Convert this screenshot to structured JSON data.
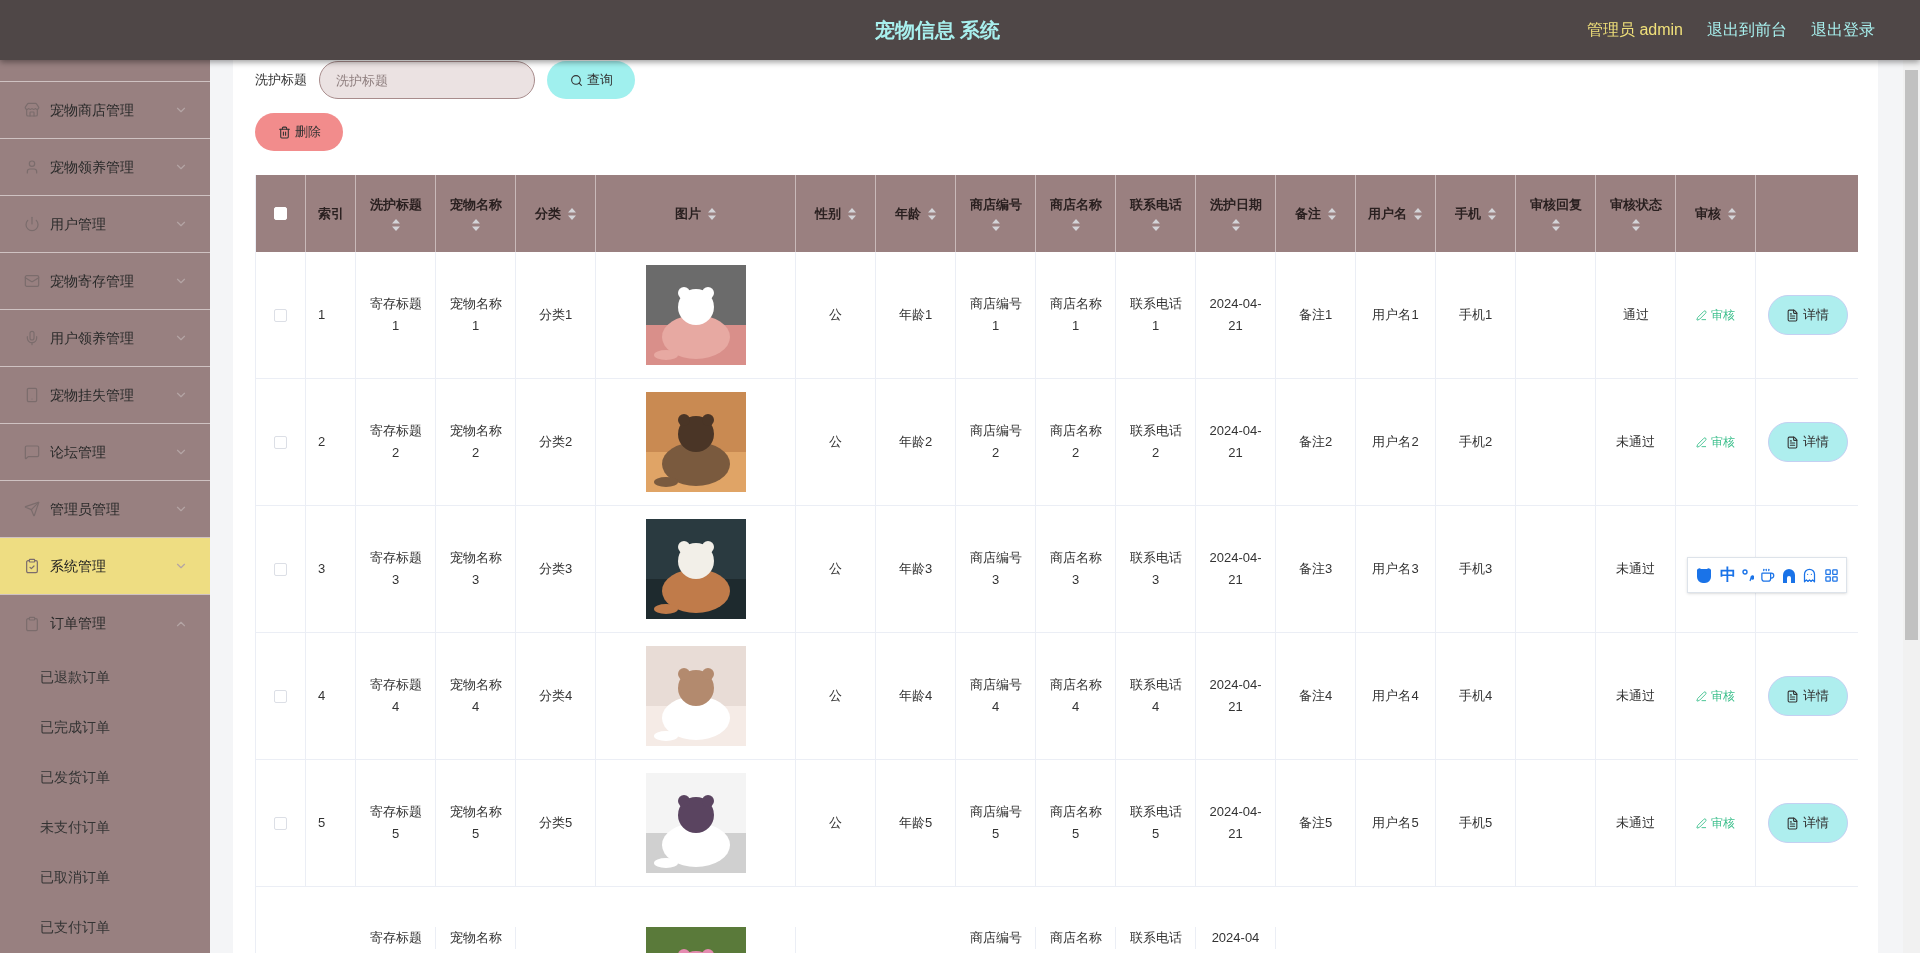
{
  "header": {
    "title": "宠物信息 系统",
    "user": "管理员 admin",
    "links": [
      "退出到前台",
      "退出登录"
    ]
  },
  "sidebar": {
    "items": [
      {
        "label": "宠物商店管理",
        "selected": false,
        "expanded": false
      },
      {
        "label": "宠物领养管理",
        "selected": false,
        "expanded": false
      },
      {
        "label": "用户管理",
        "selected": false,
        "expanded": false
      },
      {
        "label": "宠物寄存管理",
        "selected": false,
        "expanded": false
      },
      {
        "label": "用户领养管理",
        "selected": false,
        "expanded": false
      },
      {
        "label": "宠物挂失管理",
        "selected": false,
        "expanded": false
      },
      {
        "label": "论坛管理",
        "selected": false,
        "expanded": false
      },
      {
        "label": "管理员管理",
        "selected": false,
        "expanded": false
      },
      {
        "label": "系统管理",
        "selected": true,
        "expanded": false
      },
      {
        "label": "订单管理",
        "selected": false,
        "expanded": true,
        "children": [
          {
            "label": "已退款订单",
            "selected": false
          },
          {
            "label": "已完成订单",
            "selected": false
          },
          {
            "label": "已发货订单",
            "selected": false
          },
          {
            "label": "未支付订单",
            "selected": false
          },
          {
            "label": "已取消订单",
            "selected": false
          },
          {
            "label": "已支付订单",
            "selected": false
          }
        ]
      }
    ]
  },
  "search": {
    "label": "洗护标题",
    "placeholder": "洗护标题",
    "button": "查询"
  },
  "delete_button": "删除",
  "table": {
    "columns": [
      {
        "label": "索引",
        "sortable": false
      },
      {
        "label": "洗护标题",
        "sortable": true
      },
      {
        "label": "宠物名称",
        "sortable": true
      },
      {
        "label": "分类",
        "sortable": true
      },
      {
        "label": "图片",
        "sortable": true
      },
      {
        "label": "性别",
        "sortable": true
      },
      {
        "label": "年龄",
        "sortable": true
      },
      {
        "label": "商店编号",
        "sortable": true
      },
      {
        "label": "商店名称",
        "sortable": true
      },
      {
        "label": "联系电话",
        "sortable": true
      },
      {
        "label": "洗护日期",
        "sortable": true
      },
      {
        "label": "备注",
        "sortable": true
      },
      {
        "label": "用户名",
        "sortable": true
      },
      {
        "label": "手机",
        "sortable": true
      },
      {
        "label": "审核回复",
        "sortable": true
      },
      {
        "label": "审核状态",
        "sortable": true
      },
      {
        "label": "审核",
        "sortable": true
      }
    ],
    "all_checked": false,
    "rows": [
      {
        "checked": false,
        "index": "1",
        "title": "寄存标题1",
        "pet_name": "宠物名称1",
        "category": "分类1",
        "gender": "公",
        "age": "年龄1",
        "shop_no": "商店编号1",
        "shop_name": "商店名称1",
        "phone": "联系电话1",
        "date": "2024-04-21",
        "note": "备注1",
        "username": "用户名1",
        "mobile": "手机1",
        "status": "通过",
        "audit": "审核",
        "details": "详情"
      },
      {
        "checked": false,
        "index": "2",
        "title": "寄存标题2",
        "pet_name": "宠物名称2",
        "category": "分类2",
        "gender": "公",
        "age": "年龄2",
        "shop_no": "商店编号2",
        "shop_name": "商店名称2",
        "phone": "联系电话2",
        "date": "2024-04-21",
        "note": "备注2",
        "username": "用户名2",
        "mobile": "手机2",
        "status": "未通过",
        "audit": "审核",
        "details": "详情"
      },
      {
        "checked": false,
        "index": "3",
        "title": "寄存标题3",
        "pet_name": "宠物名称3",
        "category": "分类3",
        "gender": "公",
        "age": "年龄3",
        "shop_no": "商店编号3",
        "shop_name": "商店名称3",
        "phone": "联系电话3",
        "date": "2024-04-21",
        "note": "备注3",
        "username": "用户名3",
        "mobile": "手机3",
        "status": "未通过"
      },
      {
        "checked": false,
        "index": "4",
        "title": "寄存标题4",
        "pet_name": "宠物名称4",
        "category": "分类4",
        "gender": "公",
        "age": "年龄4",
        "shop_no": "商店编号4",
        "shop_name": "商店名称4",
        "phone": "联系电话4",
        "date": "2024-04-21",
        "note": "备注4",
        "username": "用户名4",
        "mobile": "手机4",
        "status": "未通过",
        "audit": "审核",
        "details": "详情"
      },
      {
        "checked": false,
        "index": "5",
        "title": "寄存标题5",
        "pet_name": "宠物名称5",
        "category": "分类5",
        "gender": "公",
        "age": "年龄5",
        "shop_no": "商店编号5",
        "shop_name": "商店名称5",
        "phone": "联系电话5",
        "date": "2024-04-21",
        "note": "备注5",
        "username": "用户名5",
        "mobile": "手机5",
        "status": "未通过",
        "audit": "审核",
        "details": "详情"
      },
      {
        "title": "寄存标题",
        "pet_name": "宠物名称",
        "shop_no": "商店编号",
        "shop_name": "商店名称",
        "phone": "联系电话",
        "date": "2024-04"
      }
    ]
  },
  "ime_toolbar": {
    "mode": "中"
  }
}
